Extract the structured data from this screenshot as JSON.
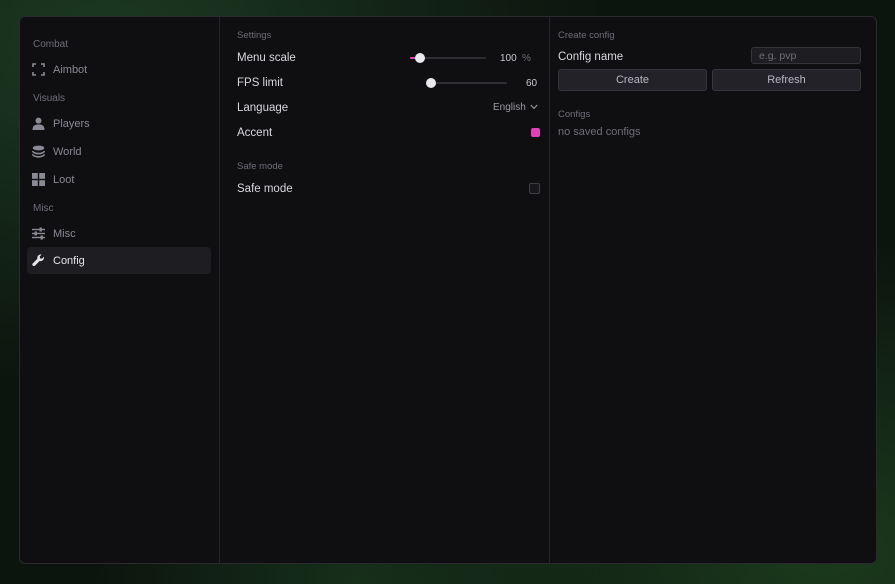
{
  "sidebar": {
    "sections": {
      "combat": "Combat",
      "visuals": "Visuals",
      "misc": "Misc"
    },
    "items": {
      "aimbot": {
        "label": "Aimbot",
        "icon": "crosshair-frame-icon"
      },
      "players": {
        "label": "Players",
        "icon": "person-icon"
      },
      "world": {
        "label": "World",
        "icon": "layers-icon"
      },
      "loot": {
        "label": "Loot",
        "icon": "grid-icon"
      },
      "misc": {
        "label": "Misc",
        "icon": "sliders-icon"
      },
      "config": {
        "label": "Config",
        "icon": "wrench-icon"
      }
    },
    "active": "config"
  },
  "settings": {
    "group_label": "Settings",
    "menu_scale": {
      "label": "Menu scale",
      "value": "100",
      "unit": "%",
      "fraction": 0.13
    },
    "fps_limit": {
      "label": "FPS limit",
      "value": "60",
      "fraction": 0.0
    },
    "language": {
      "label": "Language",
      "value": "English"
    },
    "accent": {
      "label": "Accent",
      "color": "#e040b8"
    }
  },
  "safe_mode": {
    "group_label": "Safe mode",
    "toggle": {
      "label": "Safe mode",
      "checked": false
    }
  },
  "create_config": {
    "group_label": "Create config",
    "name_label": "Config name",
    "name_placeholder": "e.g. pvp",
    "name_value": "",
    "create_label": "Create",
    "refresh_label": "Refresh"
  },
  "configs": {
    "group_label": "Configs",
    "empty_text": "no saved configs"
  },
  "colors": {
    "accent": "#e040b8",
    "panel_bg": "#0f0f12",
    "active_item_bg": "#1d1d22"
  }
}
